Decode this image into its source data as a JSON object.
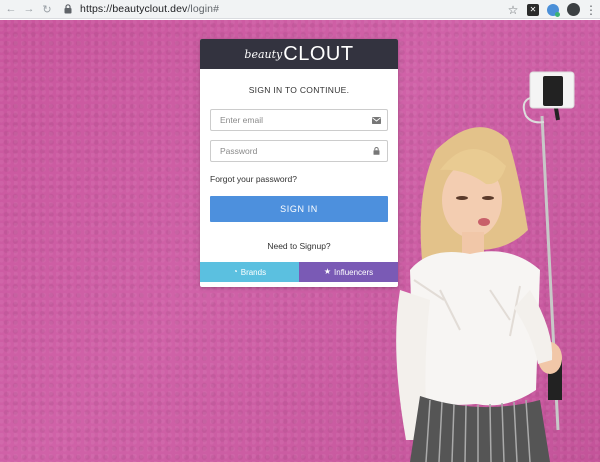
{
  "browser": {
    "url_host": "https://beautyclout.dev",
    "url_path": "/login#",
    "icons": [
      "back-icon",
      "forward-icon",
      "reload-icon",
      "lock-icon",
      "star-icon",
      "extension-x-icon",
      "extension-globe-icon",
      "profile-icon",
      "menu-icon"
    ]
  },
  "logo": {
    "small": "beauty",
    "big": "CLOUT"
  },
  "login": {
    "heading": "SIGN IN TO CONTINUE.",
    "email_placeholder": "Enter email",
    "password_placeholder": "Password",
    "forgot_label": "Forgot your password?",
    "signin_label": "SIGN IN",
    "signup_prompt": "Need to Signup?",
    "brands_label": "Brands",
    "influencers_label": "Influencers"
  },
  "colors": {
    "background": "#cb5aa0",
    "header": "#33333f",
    "signin": "#4d90dd",
    "brands": "#5bc0e0",
    "influencers": "#7a5ab5"
  }
}
